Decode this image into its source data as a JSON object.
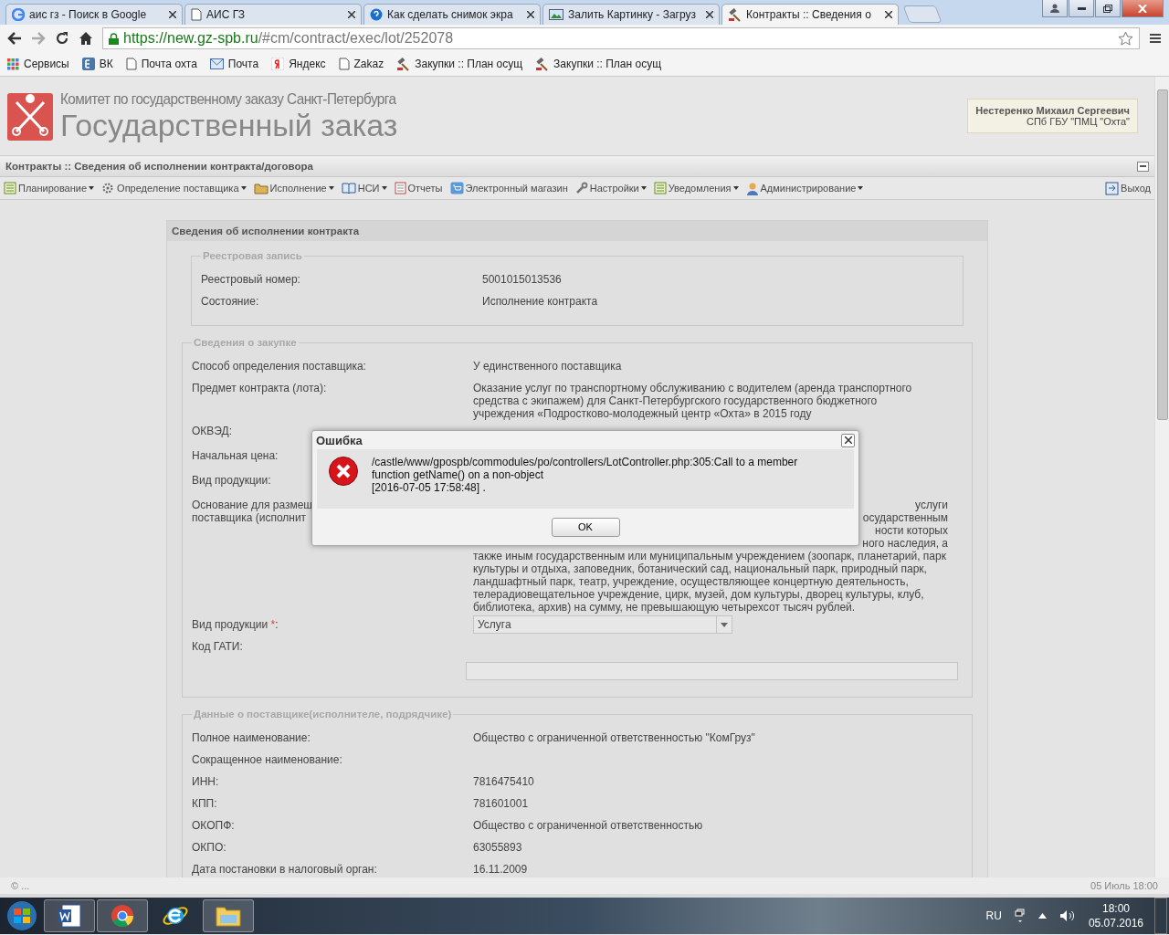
{
  "browser": {
    "tabs": [
      {
        "title": "аис гз - Поиск в Google",
        "selected": false
      },
      {
        "title": "АИС ГЗ",
        "selected": false
      },
      {
        "title": "Как сделать снимок экра",
        "selected": false
      },
      {
        "title": "Залить Картинку - Загруз",
        "selected": false
      },
      {
        "title": "Контракты :: Сведения о",
        "selected": true
      }
    ],
    "url_host": "https://new.gz-spb.ru",
    "url_path": "/#cm/contract/exec/lot/252078",
    "bookmarks": [
      "Сервисы",
      "ВК",
      "Почта охта",
      "Почта",
      "Яндекс",
      "Zakaz",
      "Закупки :: План осущ",
      "Закупки :: План осущ"
    ]
  },
  "header": {
    "org": "Комитет по государственному заказу Санкт-Петербурга",
    "title": "Государственный заказ",
    "user_name": "Нестеренко Михаил Сергеевич",
    "user_org": "СПб ГБУ \"ПМЦ \"Охта\""
  },
  "page_title": "Контракты :: Сведения об исполнении контракта/договора",
  "menu": [
    {
      "label": "Планирование",
      "dropdown": true
    },
    {
      "label": "Определение поставщика",
      "dropdown": true
    },
    {
      "label": "Исполнение",
      "dropdown": true
    },
    {
      "label": "НСИ",
      "dropdown": true
    },
    {
      "label": "Отчеты",
      "dropdown": false
    },
    {
      "label": "Электронный магазин",
      "dropdown": false
    },
    {
      "label": "Настройки",
      "dropdown": true
    },
    {
      "label": "Уведомления",
      "dropdown": true
    },
    {
      "label": "Администрирование",
      "dropdown": true
    }
  ],
  "logout": "Выход",
  "panel": {
    "title": "Сведения об исполнении контракта",
    "sections": [
      {
        "title": "Реестровая запись",
        "rows": [
          {
            "kind": "text",
            "label": "Реестровый номер:",
            "value": "5001015013536"
          },
          {
            "kind": "text",
            "label": "Состояние:",
            "value": "Исполнение контракта"
          }
        ]
      },
      {
        "title": "Сведения о закупке",
        "rows": [
          {
            "kind": "text",
            "label": "Способ определения поставщика:",
            "value": "У единственного поставщика"
          },
          {
            "kind": "text",
            "label": "Предмет контракта (лота):",
            "value": "Оказание услуг по транспортному обслуживанию с водителем (аренда транспортного средства с экипажем) для Санкт-Петербургского государственного бюджетного учреждения «Подростково-молодежный центр «Охта» в 2015 году"
          },
          {
            "kind": "covered",
            "label": "ОКВЭД:"
          },
          {
            "kind": "covered",
            "label": "Начальная цена:"
          },
          {
            "kind": "covered",
            "label": "Вид продукции:"
          },
          {
            "kind": "partial",
            "label_lines": [
              "Основание для размещ",
              "поставщика (исполнит"
            ],
            "cut_lines": [
              "услуги",
              "осударственным",
              "ности которых",
              "ного наследия, а"
            ],
            "value": "также иным государственным или муниципальным учреждением (зоопарк, планетарий, парк культуры и отдыха, заповедник, ботанический сад, национальный парк, природный парк, ландшафтный парк, театр, учреждение, осуществляющее концертную деятельность, телерадиовещательное учреждение, цирк, музей, дом культуры, дворец культуры, клуб, библиотека, архив) на сумму, не превышающую четырехсот тысяч рублей."
          },
          {
            "kind": "select",
            "label": "Вид продукции",
            "mark": "*",
            "colon": ":",
            "value": "Услуга"
          },
          {
            "kind": "input",
            "label": "Код ГАТИ:"
          }
        ]
      },
      {
        "title": "Данные о поставщике(исполнителе, подрядчике)",
        "rows": [
          {
            "kind": "text",
            "label": "Полное наименование:",
            "value": "Общество с ограниченной ответственностью \"КомГруз\""
          },
          {
            "kind": "text",
            "label": "Сокращенное наименование:"
          },
          {
            "kind": "text",
            "label": "ИНН:",
            "value": "7816475410"
          },
          {
            "kind": "text",
            "label": "КПП:",
            "value": "781601001"
          },
          {
            "kind": "text",
            "label": "ОКОПФ:",
            "value": "Общество с ограниченной ответственностью"
          },
          {
            "kind": "text",
            "label": "ОКПО:",
            "value": "63055893"
          },
          {
            "kind": "text",
            "label": "Дата постановки в налоговый орган:",
            "value": "16.11.2009"
          }
        ]
      }
    ]
  },
  "dialog": {
    "title": "Ошибка",
    "message": "/castle/www/gpospb/commodules/po/controllers/LotController.php:305:Call to a member function getName() on a non-object",
    "timestamp": "[2016-07-05 17:58:48] .",
    "button": "OK"
  },
  "status_bar": {
    "left": "© ...",
    "right": "05 Июль 18:00"
  },
  "taskbar": {
    "apps": [
      {
        "running": true
      },
      {
        "running": true
      },
      {
        "running": false
      },
      {
        "running": true
      }
    ],
    "lang": "RU",
    "time": "18:00",
    "date": "05.07.2016"
  }
}
